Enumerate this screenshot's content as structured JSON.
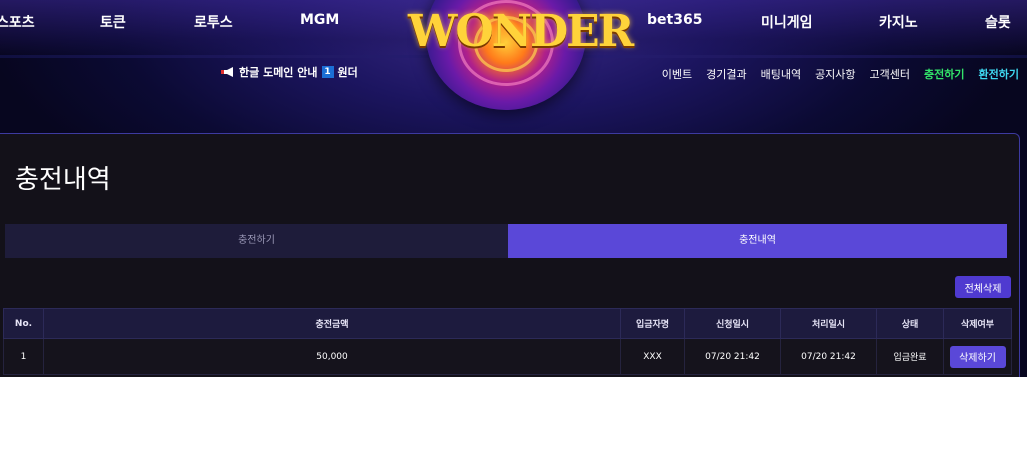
{
  "top_nav": {
    "items": [
      "스포츠",
      "토큰",
      "로투스",
      "MGM",
      "bet365",
      "미니게임",
      "카지노",
      "슬롯"
    ]
  },
  "logo": {
    "text": "WONDER"
  },
  "notice": {
    "text_a": "한글 도메인 안내",
    "badge": "1",
    "text_b": "원더"
  },
  "sub_nav": {
    "items": [
      "이벤트",
      "경기결과",
      "배팅내역",
      "공지사항",
      "고객센터",
      "충전하기",
      "환전하기"
    ]
  },
  "page": {
    "title": "충전내역"
  },
  "tabs": [
    "충전하기",
    "충전내역"
  ],
  "actions": {
    "delete_all": "전체삭제"
  },
  "table": {
    "headers": [
      "No.",
      "충전금액",
      "입금자명",
      "신청일시",
      "처리일시",
      "상태",
      "삭제여부"
    ],
    "rows": [
      {
        "no": "1",
        "amount": "50,000",
        "depositor": "XXX",
        "requested": "07/20 21:42",
        "processed": "07/20 21:42",
        "status": "입금완료",
        "action": "삭제하기"
      }
    ]
  },
  "colors": {
    "accent": "#5a48d8",
    "charge": "#33e36a",
    "withdraw": "#3fd8f0"
  }
}
